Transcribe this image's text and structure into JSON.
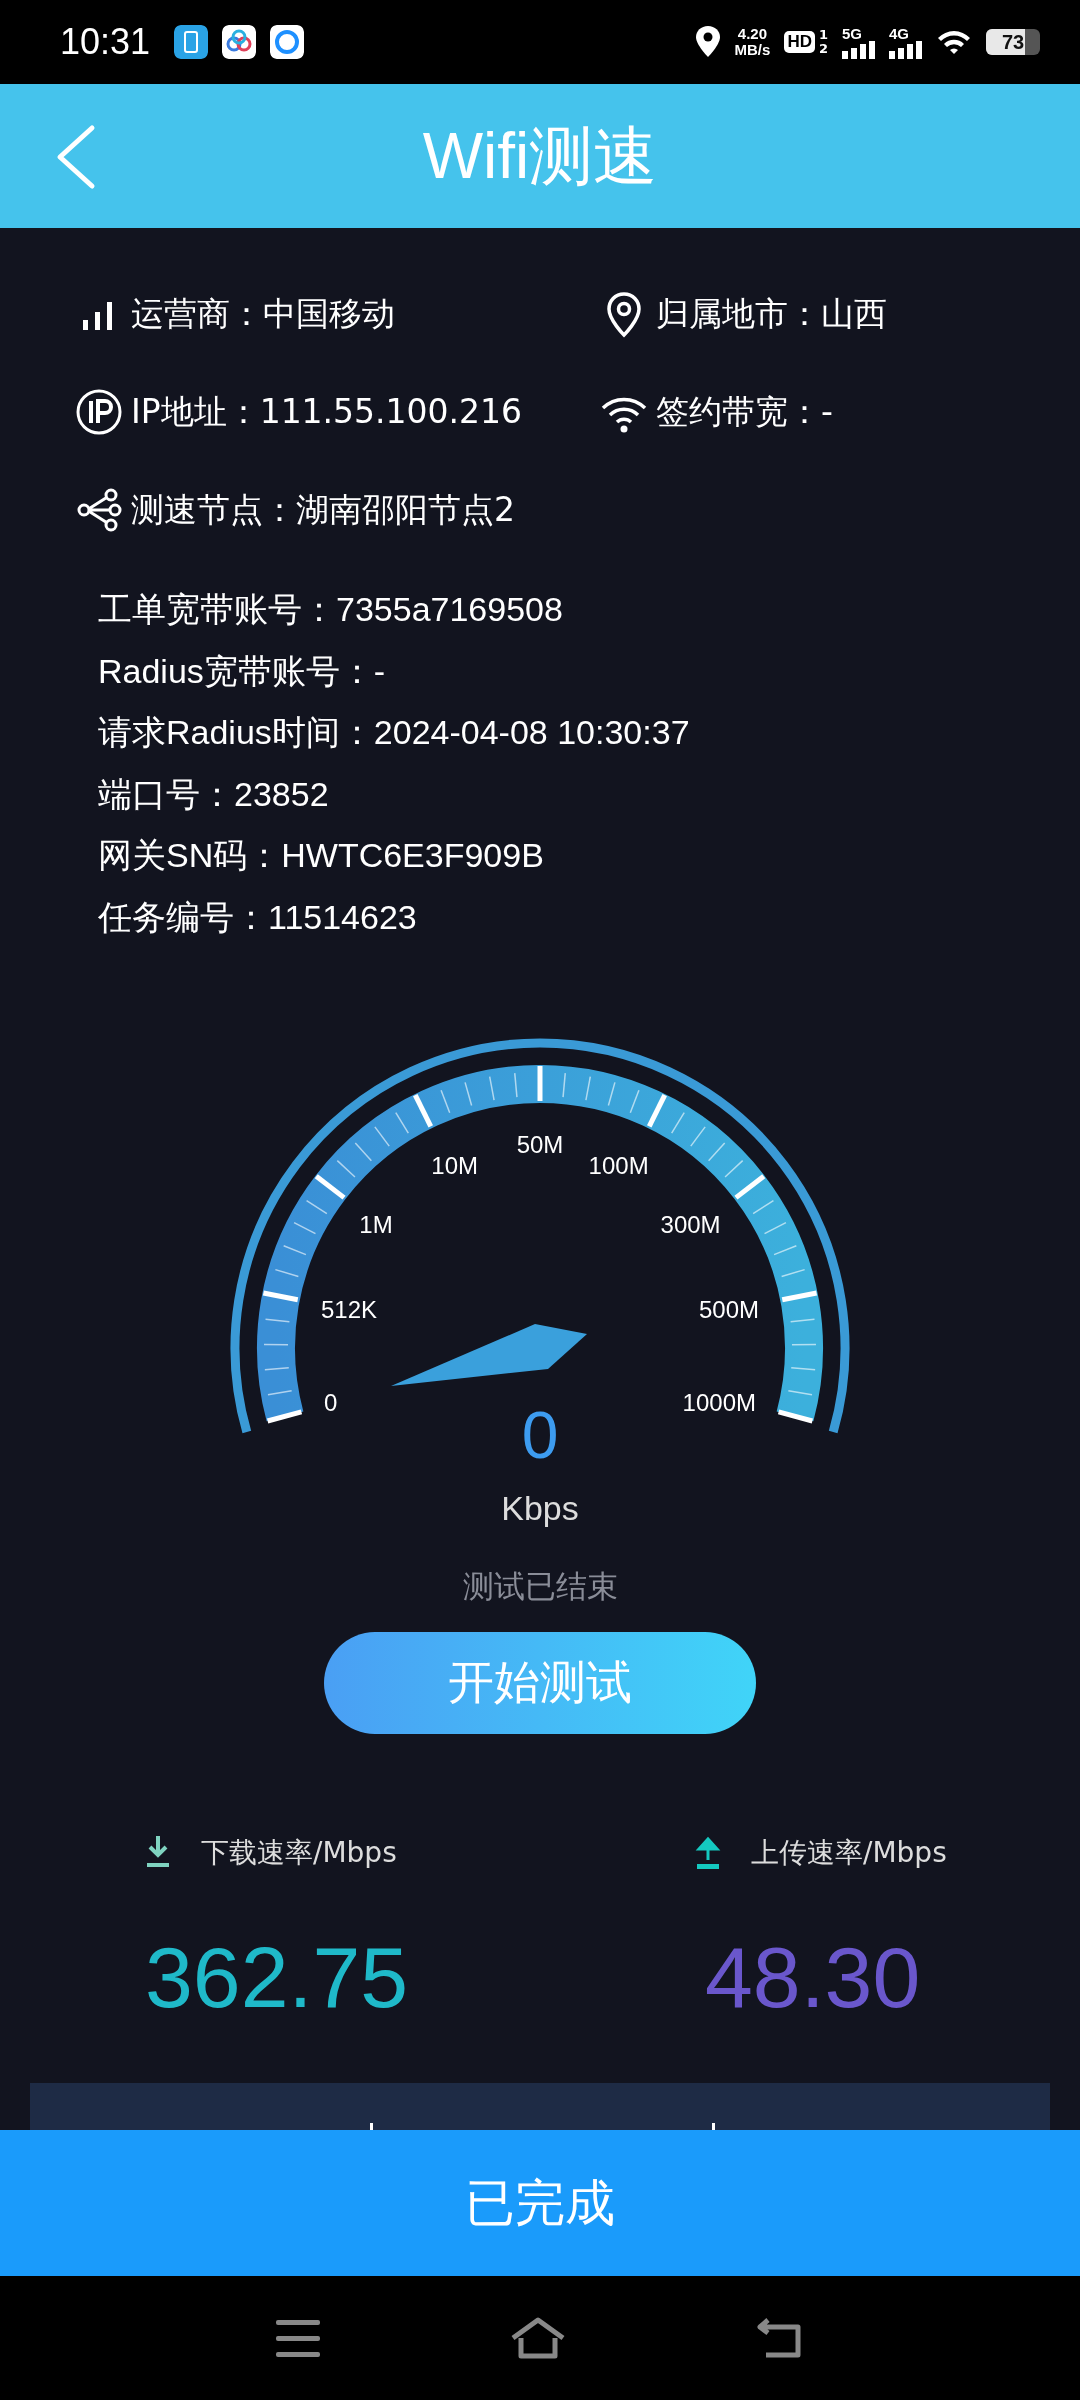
{
  "status_bar": {
    "time": "10:31",
    "net_speed": "4.20",
    "net_unit": "MB/s",
    "hd": "HD",
    "sims": [
      "1",
      "2"
    ],
    "signals": [
      {
        "label": "5G"
      },
      {
        "label": "4G"
      }
    ],
    "battery": "73"
  },
  "header": {
    "title": "Wifi测速"
  },
  "info": [
    {
      "kind": "signal",
      "text": "运营商：中国移动"
    },
    {
      "kind": "location",
      "text": "归属地市：山西"
    },
    {
      "kind": "ip",
      "text": "IP地址：111.55.100.216"
    },
    {
      "kind": "wifi",
      "text": "签约带宽：-"
    },
    {
      "kind": "nodes",
      "text": "测速节点：湖南邵阳节点2"
    }
  ],
  "details": [
    "工单宽带账号：7355a7169508",
    "Radius宽带账号：-",
    "请求Radius时间：2024-04-08 10:30:37",
    "端口号：23852",
    "网关SN码：HWTC6E3F909B",
    "任务编号：11514623"
  ],
  "gauge": {
    "scale": [
      "0",
      "512K",
      "1M",
      "10M",
      "50M",
      "100M",
      "300M",
      "500M",
      "1000M"
    ],
    "reading": "0",
    "unit": "Kbps"
  },
  "status_text": "测试已结束",
  "start_button": "开始测试",
  "results": [
    {
      "kind": "download",
      "label": "下载速率/Mbps",
      "value": "362.75",
      "color": "#1fb9c9"
    },
    {
      "kind": "upload",
      "label": "上传速率/Mbps",
      "value": "48.30",
      "color": "#6a57cc"
    }
  ],
  "done_button": "已完成"
}
